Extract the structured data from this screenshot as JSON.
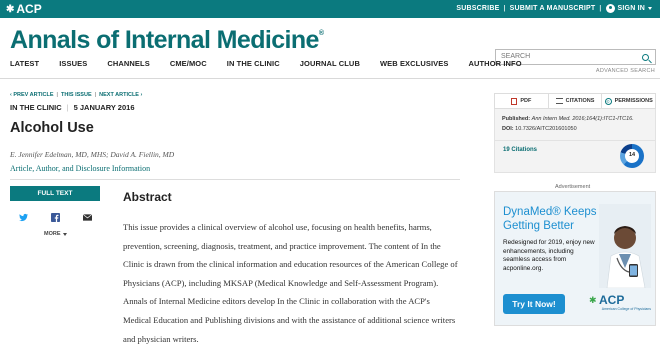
{
  "topbar": {
    "logo": "ACP",
    "subscribe": "SUBSCRIBE",
    "submit": "SUBMIT A MANUSCRIPT",
    "signin": "SIGN IN",
    "separator": "|"
  },
  "masthead": {
    "title": "Annals of Internal Medicine",
    "mark": "®"
  },
  "search": {
    "placeholder": "SEARCH",
    "advanced": "ADVANCED SEARCH"
  },
  "nav": [
    "LATEST",
    "ISSUES",
    "CHANNELS",
    "CME/MOC",
    "IN THE CLINIC",
    "JOURNAL CLUB",
    "WEB EXCLUSIVES",
    "AUTHOR INFO"
  ],
  "article": {
    "crumbs": {
      "prev": "‹ PREV ARTICLE",
      "this": "THIS ISSUE",
      "next": "NEXT ARTICLE ›",
      "bar": "|"
    },
    "section": "IN THE CLINIC",
    "date": "5 JANUARY 2016",
    "bar": "|",
    "title": "Alcohol Use",
    "authors": "E. Jennifer Edelman, MD, MHS; David A. Fiellin, MD",
    "disclosure": "Article, Author, and Disclosure Information",
    "full_text": "FULL TEXT",
    "more": "MORE",
    "abstract_heading": "Abstract",
    "abstract": "This issue provides a clinical overview of alcohol use, focusing on health benefits, harms, prevention, screening, diagnosis, treatment, and practice improvement. The content of In the Clinic is drawn from the clinical information and education resources of the American College of Physicians (ACP), including MKSAP (Medical Knowledge and Self-Assessment Program). Annals of Internal Medicine editors develop In the Clinic in collaboration with the ACP's Medical Education and Publishing divisions and with the assistance of additional science writers and physician writers."
  },
  "sidebar": {
    "tools": {
      "pdf": "PDF",
      "citations": "CITATIONS",
      "permissions": "PERMISSIONS"
    },
    "published_label": "Published:",
    "published_value": "Ann Intern Med. 2016;164(1):ITC1-ITC16.",
    "doi_label": "DOI:",
    "doi_value": "10.7326/AITC201601050",
    "citations_label": "19 Citations",
    "altmetric": "14",
    "ad_label": "Advertisement",
    "ad": {
      "headline": "DynaMed® Keeps Getting Better",
      "body": "Redesigned for 2019, enjoy new enhancements, including seamless access from acponline.org.",
      "cta": "Try It Now!",
      "logo": "ACP",
      "logo_tag": "American College of Physicians"
    }
  },
  "colors": {
    "brand": "#0b7a7f",
    "ad_blue": "#1d8fd0"
  }
}
